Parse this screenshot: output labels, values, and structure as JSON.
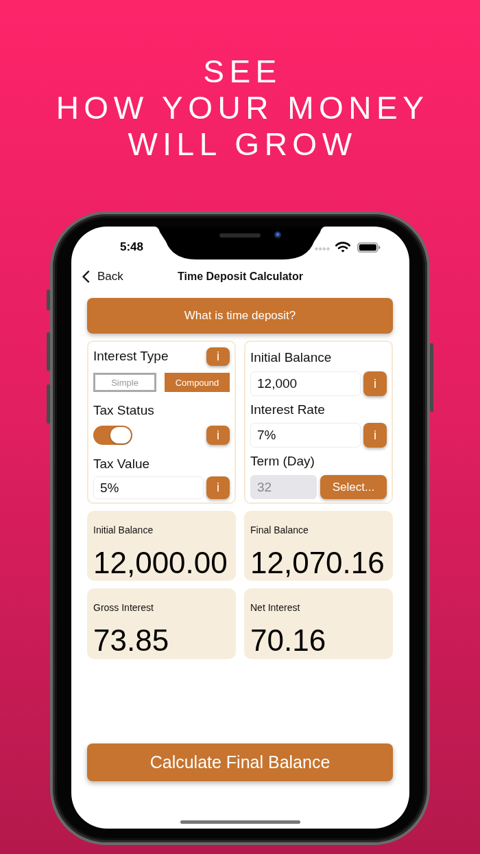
{
  "headline": {
    "lines": [
      "SEE",
      "HOW YOUR MONEY",
      "WILL GROW"
    ]
  },
  "status_bar": {
    "time": "5:48"
  },
  "nav_bar": {
    "back": "Back",
    "title": "Time Deposit Calculator"
  },
  "intro_button": {
    "label": "What is time deposit?"
  },
  "interest_type": {
    "label": "Interest Type",
    "info": "i",
    "options": [
      {
        "label": "Simple",
        "selected": false
      },
      {
        "label": "Compound",
        "selected": true
      }
    ]
  },
  "tax_status": {
    "label": "Tax Status",
    "on": true,
    "info": "i"
  },
  "tax_value": {
    "label": "Tax Value",
    "value": "5%",
    "info": "i"
  },
  "initial_balance": {
    "label": "Initial Balance",
    "value": "12,000",
    "info": "i"
  },
  "interest_rate": {
    "label": "Interest Rate",
    "value": "7%",
    "info": "i"
  },
  "term": {
    "label": "Term (Day)",
    "value": "32",
    "disabled": true,
    "button": "Select..."
  },
  "results": [
    {
      "label": "Initial Balance",
      "value": "12,000.00"
    },
    {
      "label": "Final Balance",
      "value": "12,070.16"
    },
    {
      "label": "Gross Interest",
      "value": "73.85"
    },
    {
      "label": "Net Interest",
      "value": "70.16"
    }
  ],
  "calculate_button": {
    "label": "Calculate Final Balance"
  }
}
